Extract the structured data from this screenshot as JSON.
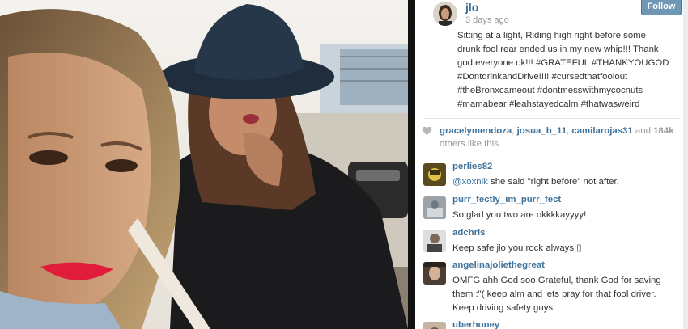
{
  "post": {
    "username": "jlo",
    "age": "3 days ago",
    "follow_label": "Follow",
    "caption_plain": "Sitting at a light, Riding high right before some drunk fool rear ended us in my new whip!!! Thank god everyone ok!!!",
    "hashtags": "#GRATEFUL #THANKYOUGOD #DontdrinkandDrive!!!! #cursedthatfoolout #theBronxcameout #dontmesswithmycocnuts #mamabear #leahstayedcalm #thatwasweird"
  },
  "likes": {
    "users": [
      "gracelymendoza",
      "josua_b_11",
      "camilarojas31"
    ],
    "sep": ", ",
    "and_text": " and ",
    "count": "184k",
    "suffix": " others like this."
  },
  "comments": [
    {
      "user": "perlies82",
      "mention": "@xoxnik",
      "text": " she said \"right before\" not after."
    },
    {
      "user": "purr_fectly_im_purr_fect",
      "text": "So glad you two are okkkkayyyy!"
    },
    {
      "user": "adchrls",
      "text": "Keep safe jlo you rock always ▯"
    },
    {
      "user": "angelinajoliethegreat",
      "text": "OMFG ahh God soo Grateful, thank God for saving them :\"( keep alm and lets pray for that fool driver. Keep driving safety guys"
    },
    {
      "user": "uberhoney"
    }
  ],
  "colors": {
    "link": "#3f729b",
    "follow_bg": "#6f97b6",
    "divider": "#111111"
  },
  "icons": {
    "likes": "heart-icon"
  }
}
